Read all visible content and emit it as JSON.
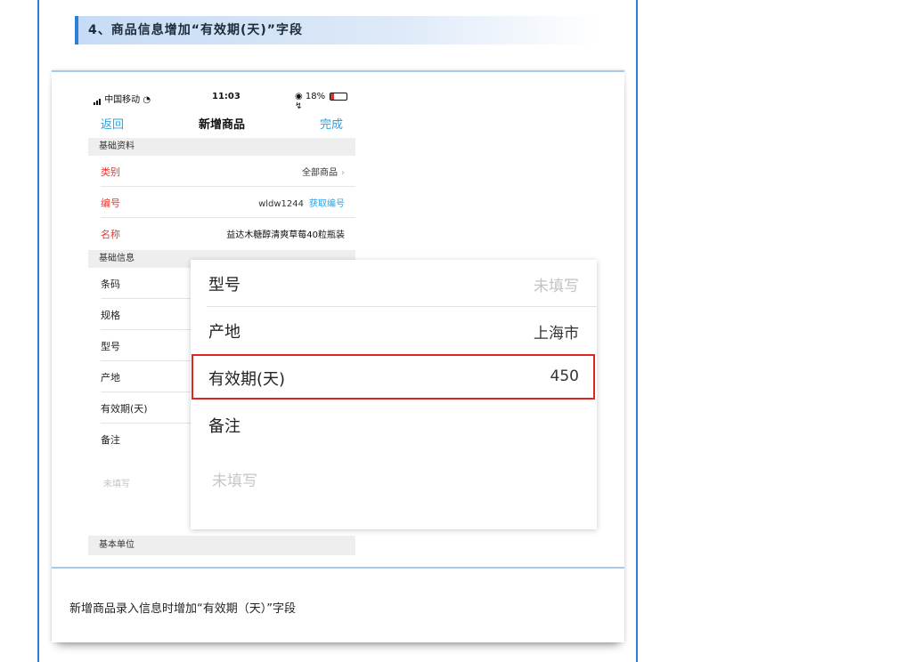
{
  "section": {
    "title": "4、商品信息增加“有效期(天)”字段"
  },
  "phone": {
    "status": {
      "carrier": "中国移动",
      "time": "11:03",
      "battery": "18%"
    },
    "nav": {
      "back": "返回",
      "title": "新增商品",
      "done": "完成"
    },
    "group_basic_data": "基础资料",
    "basic_rows": [
      {
        "label": "类别",
        "value": "全部商品"
      },
      {
        "label": "编号",
        "value": "wldw1244",
        "action": "获取编号"
      },
      {
        "label": "名称",
        "value": "益达木糖醇清爽草莓40粒瓶装"
      }
    ],
    "group_basic_info": "基础信息",
    "info_rows": [
      {
        "label": "条码"
      },
      {
        "label": "规格"
      },
      {
        "label": "型号"
      },
      {
        "label": "产地"
      },
      {
        "label": "有效期(天)"
      },
      {
        "label": "备注"
      }
    ],
    "remark_placeholder": "未填写",
    "group_unit": "基本单位"
  },
  "zoom": {
    "rows": [
      {
        "label": "型号",
        "value": "未填写"
      },
      {
        "label": "产地",
        "value": "上海市"
      },
      {
        "label": "有效期(天)",
        "value": "450"
      },
      {
        "label": "备注",
        "value": ""
      }
    ],
    "remark_placeholder": "未填写"
  },
  "caption": "新增商品录入信息时增加“有效期（天）”字段",
  "colors": {
    "accent": "#2f7fd8",
    "link": "#2aa1e0",
    "required": "#e53a2f",
    "highlight": "#e02424"
  },
  "icons": [
    "wifi-icon",
    "chevron-right-icon",
    "battery-icon",
    "signal-icon"
  ]
}
